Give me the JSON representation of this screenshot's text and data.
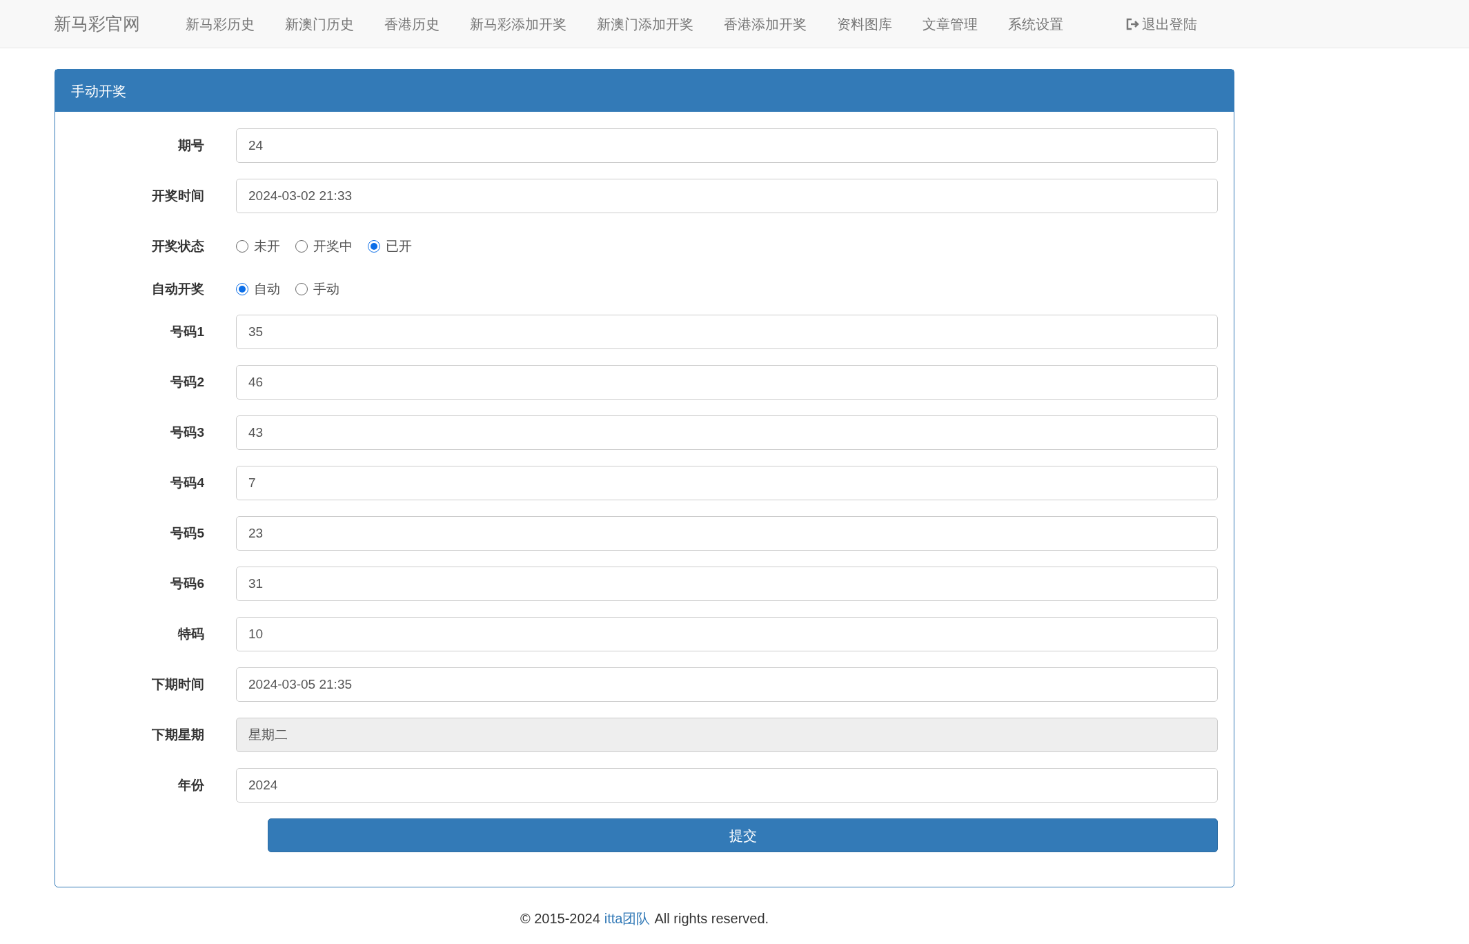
{
  "navbar": {
    "brand": "新马彩官网",
    "items": [
      "新马彩历史",
      "新澳门历史",
      "香港历史",
      "新马彩添加开奖",
      "新澳门添加开奖",
      "香港添加开奖",
      "资料图库",
      "文章管理",
      "系统设置"
    ],
    "logout": "退出登陆"
  },
  "panel": {
    "title": "手动开奖",
    "fields": [
      {
        "kind": "input",
        "label": "期号",
        "value": "24"
      },
      {
        "kind": "input",
        "label": "开奖时间",
        "value": "2024-03-02 21:33"
      },
      {
        "kind": "radio",
        "label": "开奖状态",
        "options": [
          {
            "label": "未开",
            "selected": false
          },
          {
            "label": "开奖中",
            "selected": false
          },
          {
            "label": "已开",
            "selected": true
          }
        ]
      },
      {
        "kind": "radio",
        "label": "自动开奖",
        "options": [
          {
            "label": "自动",
            "selected": true
          },
          {
            "label": "手动",
            "selected": false
          }
        ]
      },
      {
        "kind": "input",
        "label": "号码1",
        "value": "35"
      },
      {
        "kind": "input",
        "label": "号码2",
        "value": "46"
      },
      {
        "kind": "input",
        "label": "号码3",
        "value": "43"
      },
      {
        "kind": "input",
        "label": "号码4",
        "value": "7"
      },
      {
        "kind": "input",
        "label": "号码5",
        "value": "23"
      },
      {
        "kind": "input",
        "label": "号码6",
        "value": "31"
      },
      {
        "kind": "input",
        "label": "特码",
        "value": "10"
      },
      {
        "kind": "input",
        "label": "下期时间",
        "value": "2024-03-05 21:35"
      },
      {
        "kind": "readonly",
        "label": "下期星期",
        "value": "星期二"
      },
      {
        "kind": "input",
        "label": "年份",
        "value": "2024"
      }
    ],
    "submit": "提交"
  },
  "footer": {
    "prefix": "© 2015-2024",
    "link": "itta团队",
    "suffix": "All rights reserved."
  }
}
